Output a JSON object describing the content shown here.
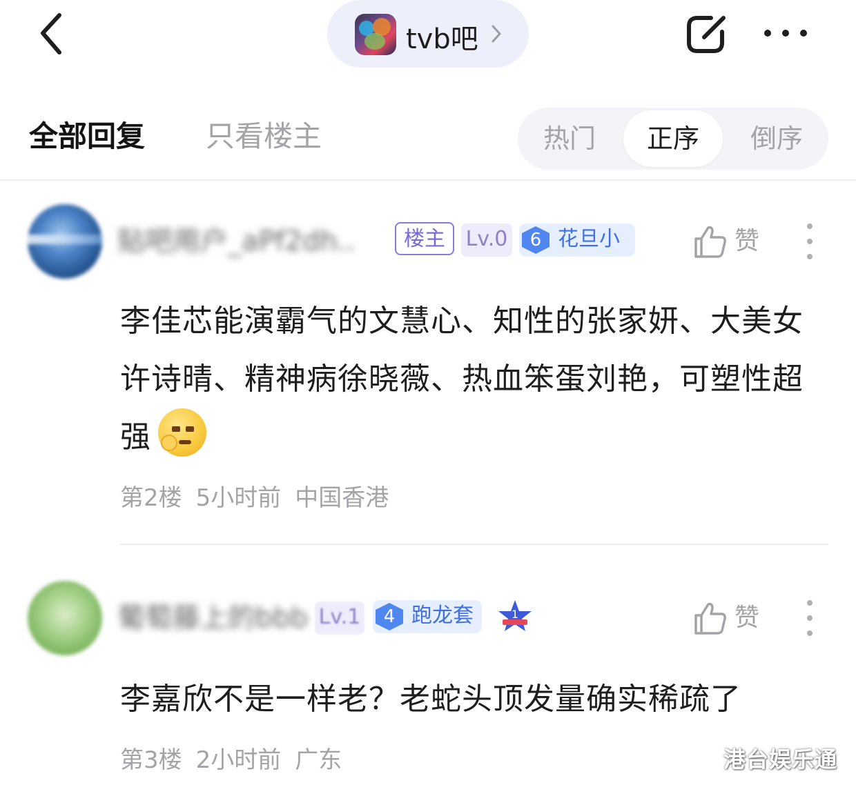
{
  "header": {
    "forum_name": "tvb吧",
    "back_icon": "chevron-left-icon",
    "edit_icon": "share-arrow-icon",
    "more_icon": "more-dots-icon"
  },
  "tabs": {
    "all_replies": "全部回复",
    "op_only": "只看楼主",
    "sort": [
      "热门",
      "正序",
      "倒序"
    ],
    "sort_selected": "正序"
  },
  "comments": [
    {
      "username": "贴吧用户_aPf2dh..",
      "badges": {
        "op": "楼主",
        "level": "Lv.0",
        "fan_level": "6",
        "fan_title": "花旦小"
      },
      "like_label": "赞",
      "text": "李佳芯能演霸气的文慧心、知性的张家妍、大美女许诗晴、精神病徐晓薇、热血笨蛋刘艳，可塑性超强",
      "floor": "第2楼",
      "time": "5小时前",
      "location": "中国香港"
    },
    {
      "username": "葡萄藤上的bbb",
      "badges": {
        "level": "Lv.1",
        "fan_level": "4",
        "fan_title": "跑龙套",
        "rank": "1"
      },
      "like_label": "赞",
      "text": "李嘉欣不是一样老？老蛇头顶发量确实稀疏了",
      "floor": "第3楼",
      "time": "2小时前",
      "location": "广东"
    }
  ],
  "watermark": "港台娱乐通",
  "colors": {
    "accent_purple": "#7a69db",
    "fan_badge_blue": "#4f86f0",
    "pill_bg": "#edf0fb",
    "muted_text": "#a4a4a8"
  }
}
